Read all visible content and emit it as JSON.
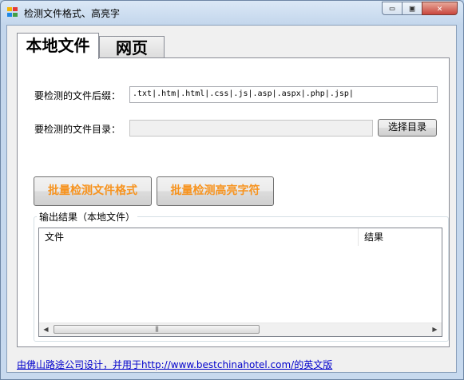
{
  "window": {
    "title": "检测文件格式、高亮字",
    "minimize": "▭",
    "maximize": "▣",
    "close": "✕"
  },
  "tabs": [
    {
      "label": "本地文件",
      "active": true
    },
    {
      "label": "网页",
      "active": false
    }
  ],
  "form": {
    "extensions_label": "要检测的文件后缀：",
    "extensions_value": ".txt|.htm|.html|.css|.js|.asp|.aspx|.php|.jsp|",
    "directory_label": "要检测的文件目录：",
    "directory_value": "",
    "browse_button": "选择目录"
  },
  "actions": {
    "batch_check_format": "批量检测文件格式",
    "batch_highlight": "批量检测高亮字符",
    "accent_color": "#f7931e"
  },
  "output": {
    "group_title": "输出结果（本地文件）",
    "columns": [
      "文件",
      "结果"
    ],
    "rows": [],
    "scroll_left": "◀",
    "scroll_right": "▶",
    "scroll_grip": "|||"
  },
  "footer": {
    "link_text": "由佛山路途公司设计，并用于http://www.bestchinahotel.com/的英文版"
  }
}
